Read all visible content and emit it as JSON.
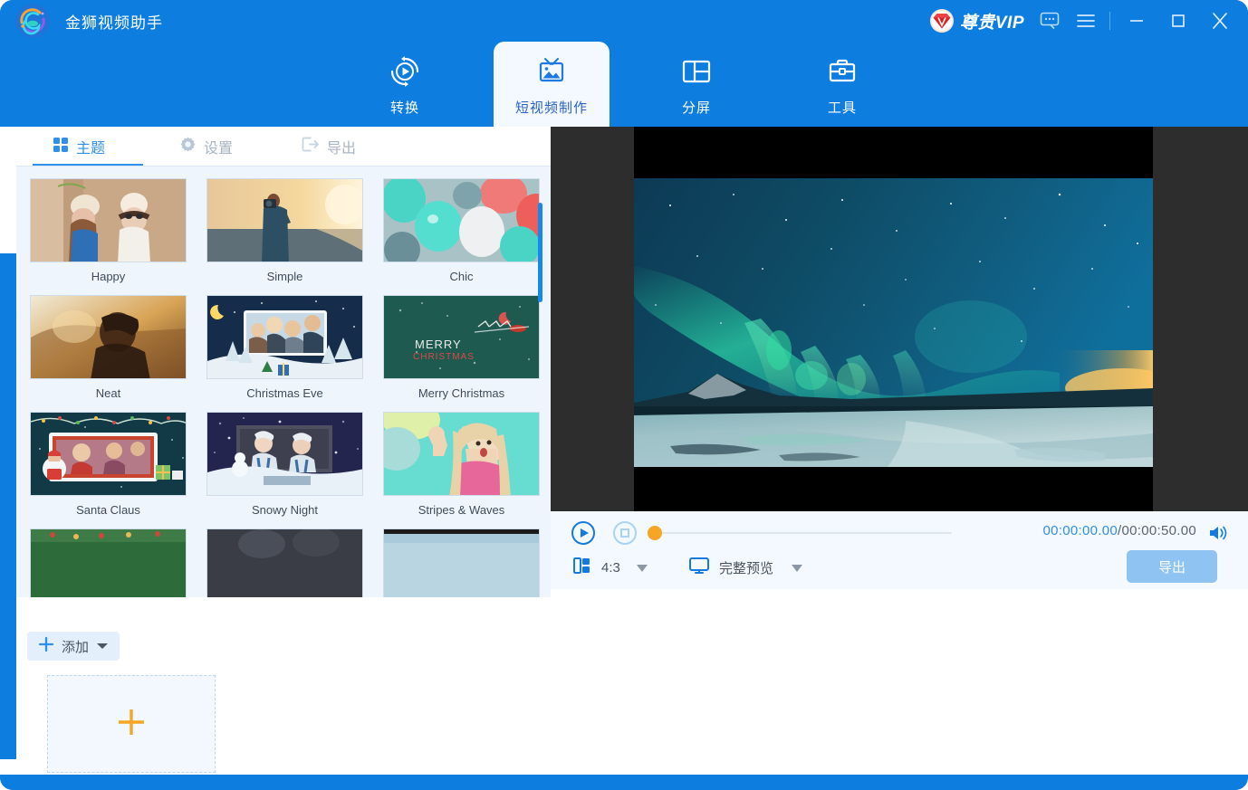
{
  "window": {
    "app_title": "金狮视频助手",
    "logo_icon": "circular-swirl-logo",
    "vip_label": "尊贵VIP",
    "vip_icon": "vip-diamond-icon",
    "chat_icon": "chat-bubble-icon",
    "menu_icon": "hamburger-menu-icon",
    "minimize_icon": "minimize-icon",
    "maximize_icon": "maximize-icon",
    "close_icon": "close-icon",
    "accent_color": "#0d7de0"
  },
  "mainnav": {
    "items": [
      {
        "label": "转换",
        "icon": "convert-circular-arrows-icon",
        "active": false
      },
      {
        "label": "短视频制作",
        "icon": "tv-photo-icon",
        "active": true
      },
      {
        "label": "分屏",
        "icon": "split-screen-icon",
        "active": false
      },
      {
        "label": "工具",
        "icon": "toolbox-icon",
        "active": false
      }
    ]
  },
  "subtabs": {
    "items": [
      {
        "label": "主题",
        "icon": "grid-dots-icon",
        "active": true
      },
      {
        "label": "设置",
        "icon": "gear-icon",
        "active": false
      },
      {
        "label": "导出",
        "icon": "export-arrow-icon",
        "active": false
      }
    ]
  },
  "themes": {
    "rows": [
      [
        {
          "name": "Happy"
        },
        {
          "name": "Simple"
        },
        {
          "name": "Chic"
        }
      ],
      [
        {
          "name": "Neat"
        },
        {
          "name": "Christmas Eve"
        },
        {
          "name": "Merry Christmas"
        }
      ],
      [
        {
          "name": "Santa Claus"
        },
        {
          "name": "Snowy Night"
        },
        {
          "name": "Stripes & Waves"
        }
      ],
      [
        {
          "name": ""
        },
        {
          "name": ""
        },
        {
          "name": ""
        }
      ]
    ]
  },
  "addzone": {
    "add_label": "添加",
    "add_icon": "plus-icon",
    "add_caret_icon": "chevron-down-icon",
    "dropzone_icon": "plus-large-icon"
  },
  "player": {
    "play_icon": "play-circle-icon",
    "stop_icon": "stop-circle-icon",
    "progress_handle_icon": "timeline-handle",
    "current_time": "00:00:00.00",
    "separator": "/",
    "duration": "00:00:50.00",
    "volume_icon": "volume-icon",
    "aspect_icon": "aspect-ratio-icon",
    "aspect_value": "4:3",
    "preview_icon": "monitor-icon",
    "preview_mode": "完整预览",
    "export_label": "导出"
  }
}
